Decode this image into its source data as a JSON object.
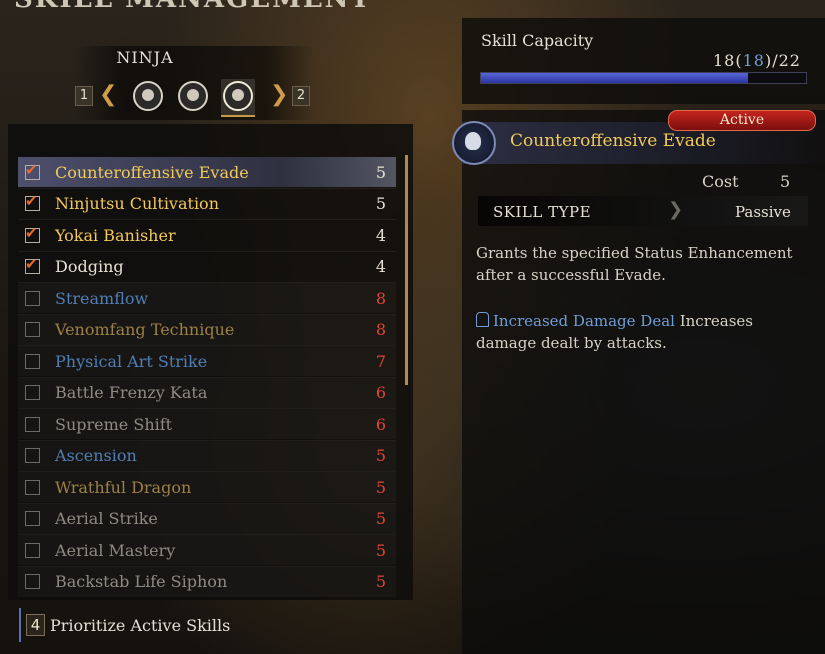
{
  "screen": {
    "title": "SKILL MANAGEMENT"
  },
  "class_selector": {
    "name": "NINJA",
    "prev_key": "1",
    "next_key": "2",
    "icons": [
      "ninja-class-icon-1",
      "ninja-class-icon-2",
      "ninja-class-icon-3"
    ],
    "selected_index": 2
  },
  "skills": [
    {
      "name": "Counteroffensive Evade",
      "cost": "5",
      "checked": true,
      "selected": true,
      "name_color": "#f2c95a",
      "cost_color": "#e6e0d4"
    },
    {
      "name": "Ninjutsu Cultivation",
      "cost": "5",
      "checked": true,
      "name_color": "#f2c95a",
      "cost_color": "#e6e0d4"
    },
    {
      "name": "Yokai Banisher",
      "cost": "4",
      "checked": true,
      "name_color": "#f2c95a",
      "cost_color": "#e6e0d4"
    },
    {
      "name": "Dodging",
      "cost": "4",
      "checked": true,
      "name_color": "#e6e0d4",
      "cost_color": "#e6e0d4"
    },
    {
      "name": "Streamflow",
      "cost": "8",
      "checked": false,
      "name_color": "#4f7fb4",
      "cost_color": "#e0443a"
    },
    {
      "name": "Venomfang Technique",
      "cost": "8",
      "checked": false,
      "name_color": "#9c8044",
      "cost_color": "#e0443a"
    },
    {
      "name": "Physical Art Strike",
      "cost": "7",
      "checked": false,
      "name_color": "#4f7fb4",
      "cost_color": "#e0443a"
    },
    {
      "name": "Battle Frenzy Kata",
      "cost": "6",
      "checked": false,
      "name_color": "#8f8a83",
      "cost_color": "#e0443a"
    },
    {
      "name": "Supreme Shift",
      "cost": "6",
      "checked": false,
      "name_color": "#8f8a83",
      "cost_color": "#e0443a"
    },
    {
      "name": "Ascension",
      "cost": "5",
      "checked": false,
      "name_color": "#4f7fb4",
      "cost_color": "#e0443a"
    },
    {
      "name": "Wrathful Dragon",
      "cost": "5",
      "checked": false,
      "name_color": "#9c8044",
      "cost_color": "#e0443a"
    },
    {
      "name": "Aerial Strike",
      "cost": "5",
      "checked": false,
      "name_color": "#8f8a83",
      "cost_color": "#e0443a"
    },
    {
      "name": "Aerial Mastery",
      "cost": "5",
      "checked": false,
      "name_color": "#8f8a83",
      "cost_color": "#e0443a"
    },
    {
      "name": "Backstab Life Siphon",
      "cost": "5",
      "checked": false,
      "name_color": "#8f8a83",
      "cost_color": "#e0443a"
    }
  ],
  "prioritize": {
    "key": "4",
    "label": "Prioritize Active Skills"
  },
  "capacity": {
    "label": "Skill Capacity",
    "used": "18",
    "used_detail": "18",
    "max": "22",
    "fill_fraction": 0.82
  },
  "detail": {
    "status": "Active",
    "title": "Counteroffensive Evade",
    "cost_label": "Cost",
    "cost_value": "5",
    "type_label": "SKILL TYPE",
    "type_value": "Passive",
    "description": "Grants the specified Status Enhancement after a successful Evade.",
    "effect_name": "Increased Damage Deal",
    "effect_text": " Increases damage dealt by attacks."
  },
  "colors": {
    "accent": "#f2c95a",
    "check": "#e86a2a",
    "capacity_bar": "#4a55c8",
    "active_tag": "#c5241f",
    "link_blue": "#6f9ed8"
  }
}
